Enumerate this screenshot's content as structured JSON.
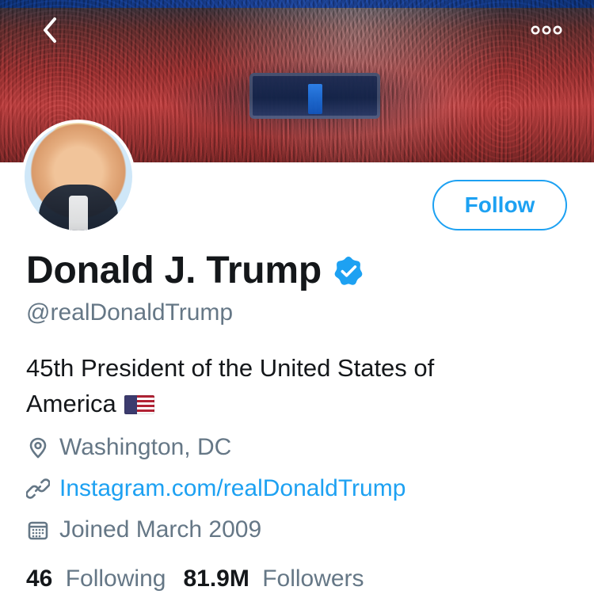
{
  "header": {
    "back_icon": "chevron-left-icon",
    "more_icon": "more-horizontal-icon"
  },
  "profile": {
    "display_name": "Donald J. Trump",
    "verified_icon": "verified-badge-icon",
    "handle": "@realDonaldTrump",
    "bio_line1": "45th President of the United States of",
    "bio_line2": "America",
    "bio_emoji": "us-flag",
    "location_icon": "location-pin-icon",
    "location": "Washington, DC",
    "link_icon": "link-icon",
    "link_text": "Instagram.com/realDonaldTrump",
    "joined_icon": "calendar-icon",
    "joined_text": "Joined March 2009",
    "following_count": "46",
    "following_label": "Following",
    "followers_count": "81.9M",
    "followers_label": "Followers"
  },
  "actions": {
    "follow_label": "Follow"
  },
  "colors": {
    "brand_blue": "#1da1f2",
    "text_primary": "#14171a",
    "text_secondary": "#657786"
  }
}
